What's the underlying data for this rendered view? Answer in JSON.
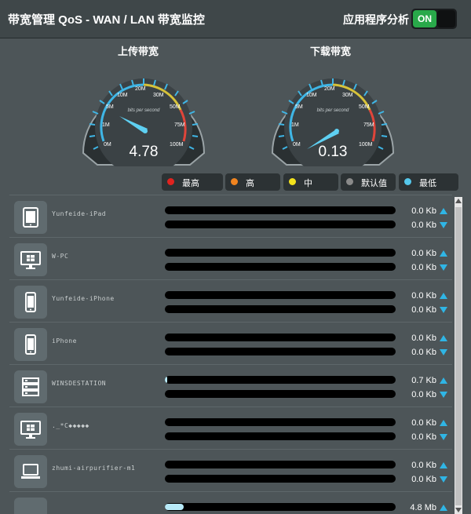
{
  "header": {
    "title": "带宽管理 QoS - WAN / LAN 带宽监控",
    "app_analysis_label": "应用程序分析",
    "toggle_label": "ON"
  },
  "gauges": [
    {
      "title": "上传带宽",
      "value": "4.78",
      "unit_label": "bits per second",
      "ticks": [
        "0M",
        "1M",
        "5M",
        "10M",
        "20M",
        "30M",
        "50M",
        "75M",
        "100M"
      ]
    },
    {
      "title": "下载带宽",
      "value": "0.13",
      "unit_label": "bits per second",
      "ticks": [
        "0M",
        "1M",
        "5M",
        "10M",
        "20M",
        "30M",
        "50M",
        "75M",
        "100M"
      ]
    }
  ],
  "priority_legend": [
    {
      "label": "最高",
      "color": "#e0231f"
    },
    {
      "label": "高",
      "color": "#f0841f"
    },
    {
      "label": "中",
      "color": "#f3e21c"
    },
    {
      "label": "默认值",
      "color": "#8a8a8a"
    },
    {
      "label": "最低",
      "color": "#55c8ec"
    }
  ],
  "devices": [
    {
      "name": "Yunfeide-iPad",
      "icon": "tablet-icon",
      "up_rate": "0.0 Kb",
      "down_rate": "0.0 Kb",
      "up_fill": 0,
      "down_fill": 0
    },
    {
      "name": "W-PC",
      "icon": "desktop-windows-icon",
      "up_rate": "0.0 Kb",
      "down_rate": "0.0 Kb",
      "up_fill": 0,
      "down_fill": 0
    },
    {
      "name": "Yunfeide-iPhone",
      "icon": "phone-icon",
      "up_rate": "0.0 Kb",
      "down_rate": "0.0 Kb",
      "up_fill": 0,
      "down_fill": 0
    },
    {
      "name": "iPhone",
      "icon": "phone-icon",
      "up_rate": "0.0 Kb",
      "down_rate": "0.0 Kb",
      "up_fill": 0,
      "down_fill": 0
    },
    {
      "name": "WINSDESTATION",
      "icon": "server-icon",
      "up_rate": "0.7 Kb",
      "down_rate": "0.0 Kb",
      "up_fill": 0.01,
      "down_fill": 0
    },
    {
      "name": "._*C◆◆◆◆◆",
      "icon": "desktop-windows-icon",
      "up_rate": "0.0 Kb",
      "down_rate": "0.0 Kb",
      "up_fill": 0,
      "down_fill": 0
    },
    {
      "name": "zhumi-airpurifier-m1",
      "icon": "laptop-icon",
      "up_rate": "0.0 Kb",
      "down_rate": "0.0 Kb",
      "up_fill": 0,
      "down_fill": 0
    },
    {
      "name": "",
      "icon": "device-icon",
      "up_rate": "4.8 Mb",
      "down_rate": "",
      "up_fill": 0.08,
      "down_fill": 0
    }
  ]
}
